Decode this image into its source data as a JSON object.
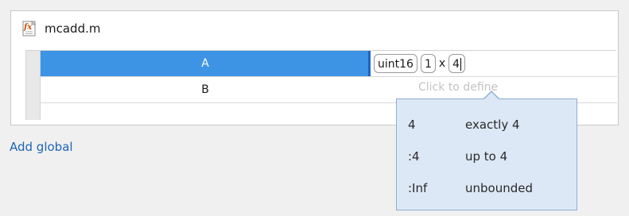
{
  "file": {
    "icon": "function-file-icon",
    "name": "mcadd.m"
  },
  "inputs": [
    {
      "name": "A",
      "selected": true,
      "type": {
        "class": "uint16",
        "dim1": "1",
        "times": "x",
        "dim2": "4"
      }
    },
    {
      "name": "B",
      "selected": false,
      "placeholder": "Click to define"
    }
  ],
  "add_global_label": "Add global",
  "size_popup": {
    "options": [
      {
        "key": "4",
        "label": "exactly 4"
      },
      {
        "key": ":4",
        "label": "up to 4"
      },
      {
        "key": ":Inf",
        "label": "unbounded"
      }
    ]
  },
  "colors": {
    "selection": "#3d94e4",
    "link": "#1f64b4",
    "popup_bg": "#dce8f5",
    "popup_border": "#8eaed2"
  }
}
